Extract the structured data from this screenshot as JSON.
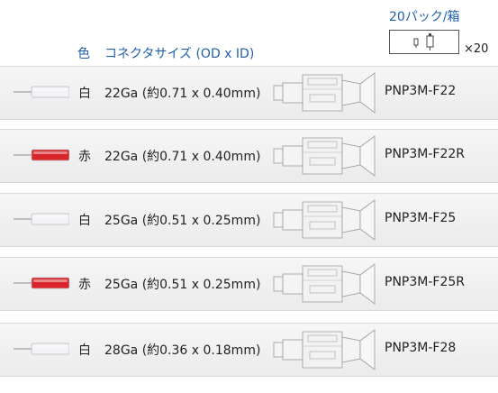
{
  "header": {
    "color_label": "色",
    "connector_label": "コネクタサイズ (OD x ID)",
    "pack_label": "20パック/箱",
    "pack_multiplier": "×20"
  },
  "rows": [
    {
      "color": "白",
      "size": "22Ga (約0.71 x 0.40mm)",
      "part": "PNP3M-F22",
      "tube_color": "#f3f3f7"
    },
    {
      "color": "赤",
      "size": "22Ga (約0.71 x 0.40mm)",
      "part": "PNP3M-F22R",
      "tube_color": "#d8242a"
    },
    {
      "color": "白",
      "size": "25Ga (約0.51 x 0.25mm)",
      "part": "PNP3M-F25",
      "tube_color": "#f3f3f7"
    },
    {
      "color": "赤",
      "size": "25Ga (約0.51 x 0.25mm)",
      "part": "PNP3M-F25R",
      "tube_color": "#d8242a"
    },
    {
      "color": "白",
      "size": "28Ga (約0.36 x 0.18mm)",
      "part": "PNP3M-F28",
      "tube_color": "#f3f3f7"
    }
  ]
}
